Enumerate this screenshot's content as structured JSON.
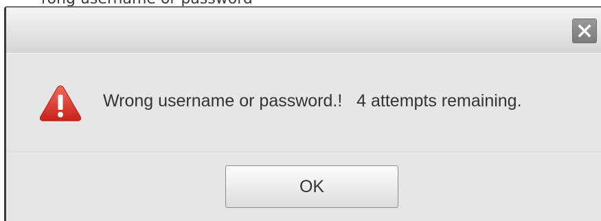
{
  "backdrop": {
    "partial_text": "rong username or password"
  },
  "dialog": {
    "close_icon": "close-icon",
    "warning_icon": "warning-triangle-icon",
    "message": "Wrong username or password.!   4 attempts remaining.",
    "ok_label": "OK"
  },
  "colors": {
    "dialog_background": "#e6e6e6",
    "warning_red": "#e03a2f",
    "close_button": "#8a8a8a"
  }
}
